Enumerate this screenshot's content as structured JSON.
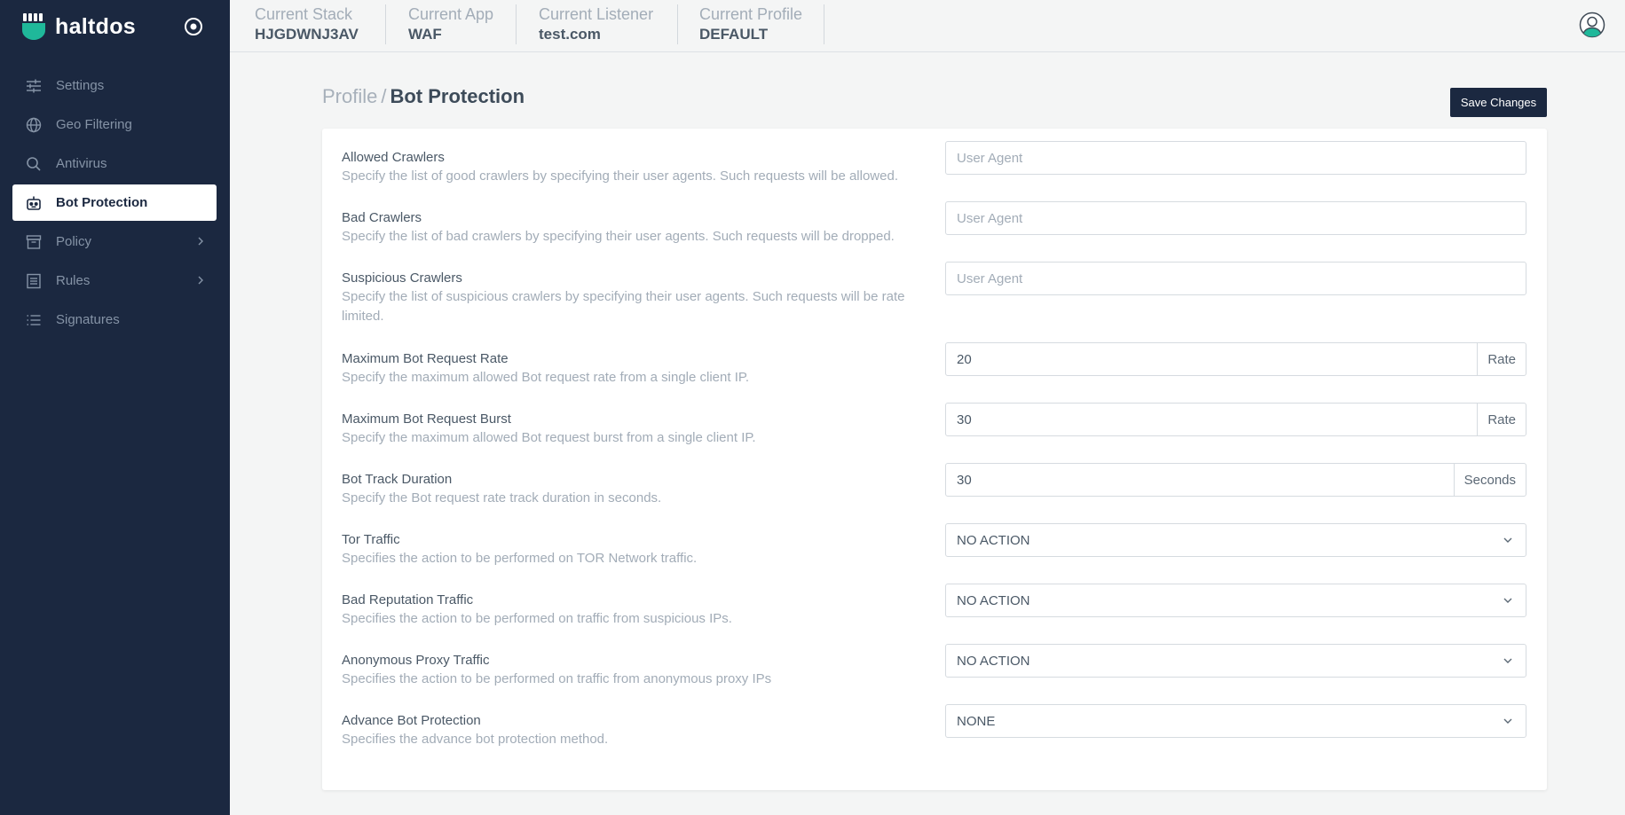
{
  "brand": {
    "name": "haltdos"
  },
  "sidebar": {
    "items": [
      {
        "label": "Settings",
        "icon": "sliders-icon"
      },
      {
        "label": "Geo Filtering",
        "icon": "globe-icon"
      },
      {
        "label": "Antivirus",
        "icon": "search-icon"
      },
      {
        "label": "Bot Protection",
        "icon": "robot-icon",
        "active": true
      },
      {
        "label": "Policy",
        "icon": "archive-icon",
        "submenu": true
      },
      {
        "label": "Rules",
        "icon": "list-box-icon",
        "submenu": true
      },
      {
        "label": "Signatures",
        "icon": "list-icon"
      }
    ]
  },
  "header": {
    "stack": {
      "label": "Current Stack",
      "value": "HJGDWNJ3AV"
    },
    "app": {
      "label": "Current App",
      "value": "WAF"
    },
    "listener": {
      "label": "Current Listener",
      "value": "test.com"
    },
    "profile": {
      "label": "Current Profile",
      "value": "DEFAULT"
    }
  },
  "page": {
    "breadcrumb_parent": "Profile",
    "breadcrumb_sep": "/",
    "breadcrumb_current": "Bot Protection",
    "save_label": "Save Changes"
  },
  "form": {
    "allowed_crawlers": {
      "title": "Allowed Crawlers",
      "desc": "Specify the list of good crawlers by specifying their user agents. Such requests will be allowed.",
      "placeholder": "User Agent"
    },
    "bad_crawlers": {
      "title": "Bad Crawlers",
      "desc": "Specify the list of bad crawlers by specifying their user agents. Such requests will be dropped.",
      "placeholder": "User Agent"
    },
    "suspicious_crawlers": {
      "title": "Suspicious Crawlers",
      "desc": "Specify the list of suspicious crawlers by specifying their user agents. Such requests will be rate limited.",
      "placeholder": "User Agent"
    },
    "max_rate": {
      "title": "Maximum Bot Request Rate",
      "desc": "Specify the maximum allowed Bot request rate from a single client IP.",
      "value": "20",
      "unit": "Rate"
    },
    "max_burst": {
      "title": "Maximum Bot Request Burst",
      "desc": "Specify the maximum allowed Bot request burst from a single client IP.",
      "value": "30",
      "unit": "Rate"
    },
    "track_duration": {
      "title": "Bot Track Duration",
      "desc": "Specify the Bot request rate track duration in seconds.",
      "value": "30",
      "unit": "Seconds"
    },
    "tor_traffic": {
      "title": "Tor Traffic",
      "desc": "Specifies the action to be performed on TOR Network traffic.",
      "value": "NO ACTION"
    },
    "bad_reputation": {
      "title": "Bad Reputation Traffic",
      "desc": "Specifies the action to be performed on traffic from suspicious IPs.",
      "value": "NO ACTION"
    },
    "anonymous_proxy": {
      "title": "Anonymous Proxy Traffic",
      "desc": "Specifies the action to be performed on traffic from anonymous proxy IPs",
      "value": "NO ACTION"
    },
    "advance_bot": {
      "title": "Advance Bot Protection",
      "desc": "Specifies the advance bot protection method.",
      "value": "NONE"
    }
  },
  "colors": {
    "sidebar_bg": "#1b2840",
    "accent": "#1fb89a",
    "page_bg": "#f4f5f5"
  }
}
